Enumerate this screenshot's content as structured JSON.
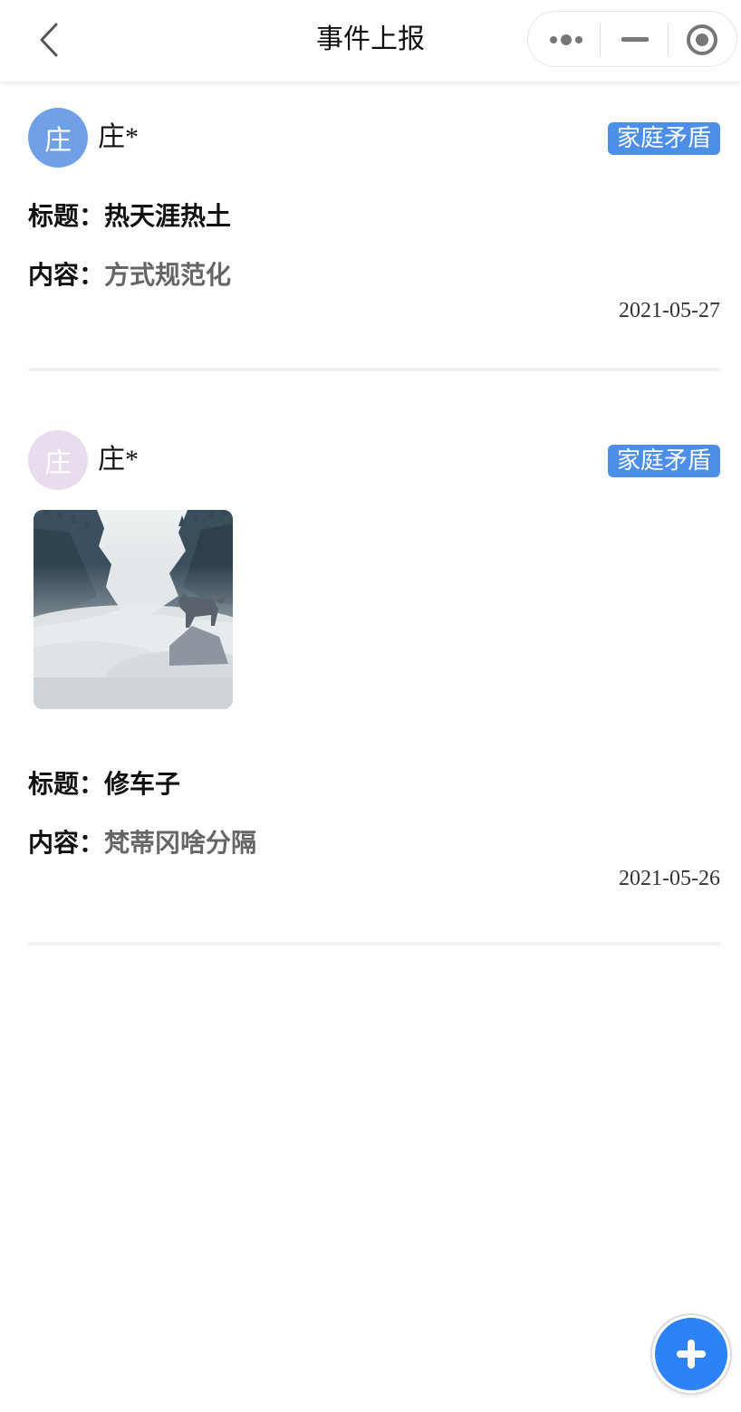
{
  "header": {
    "title": "事件上报",
    "back_icon": "chevron-left-icon",
    "capsule_icons": [
      "more-dots-icon",
      "minimize-icon",
      "record-icon"
    ]
  },
  "posts": [
    {
      "avatar_char": "庄",
      "avatar_color": "#6fa0e6",
      "username": "庄*",
      "tag": "家庭矛盾",
      "tag_color": "#4d8ee8",
      "has_image": false,
      "title_label": "标题：",
      "title": "热天涯热土",
      "content_label": "内容：",
      "content": "方式规范化",
      "date": "2021-05-27"
    },
    {
      "avatar_char": "庄",
      "avatar_color": "#e9dcec",
      "username": "庄*",
      "tag": "家庭矛盾",
      "tag_color": "#4d8ee8",
      "has_image": true,
      "image_desc": "misty-forest-wolf-photo",
      "title_label": "标题：",
      "title": "修车子",
      "content_label": "内容：",
      "content": "梵蒂冈啥分隔",
      "date": "2021-05-26"
    }
  ],
  "fab": {
    "icon": "plus-icon",
    "color": "#2d82f5"
  }
}
